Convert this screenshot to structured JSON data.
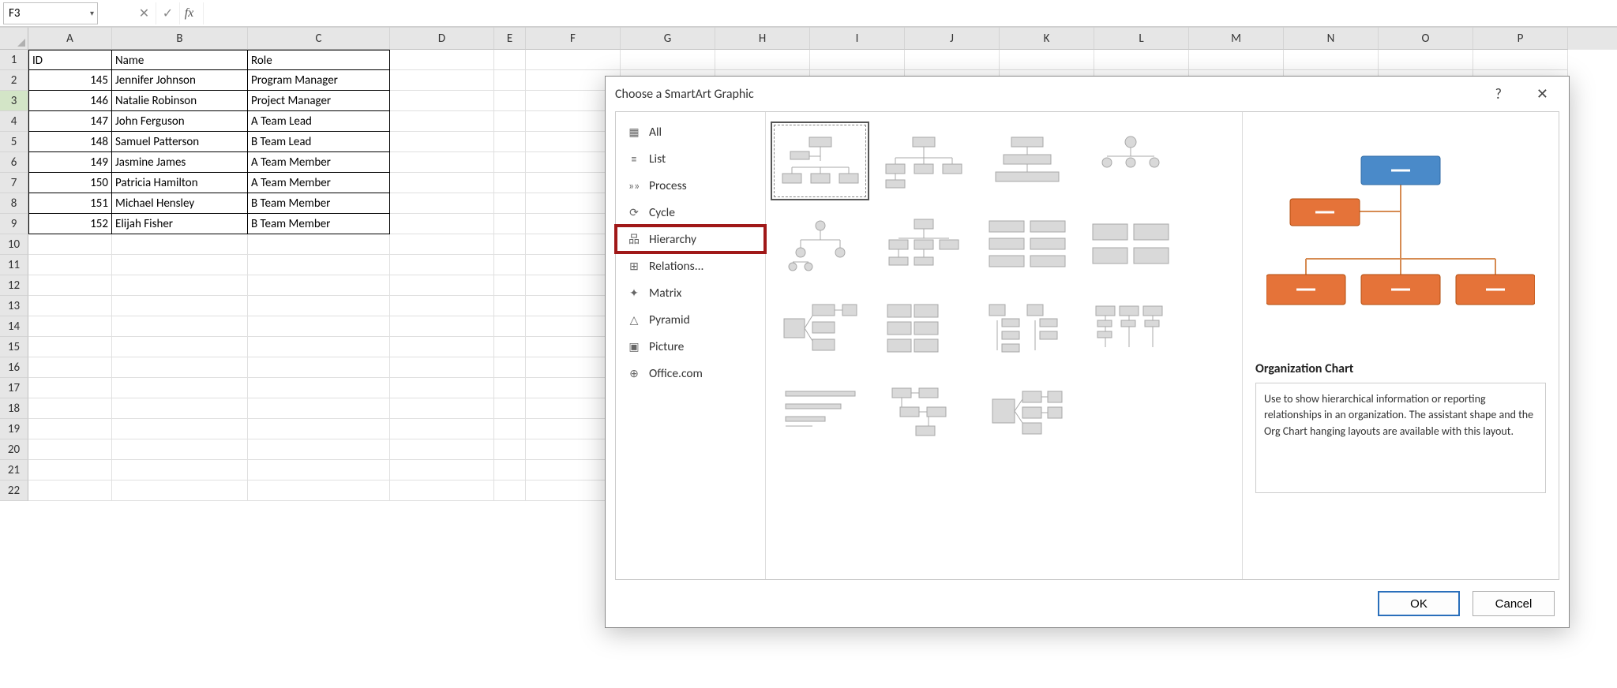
{
  "formula_bar": {
    "cell_ref": "F3",
    "fx": "fx",
    "value": ""
  },
  "columns": [
    "A",
    "B",
    "C",
    "D",
    "E",
    "F",
    "G",
    "H",
    "I",
    "J",
    "K",
    "L",
    "M",
    "N",
    "O",
    "P"
  ],
  "row_numbers": [
    1,
    2,
    3,
    4,
    5,
    6,
    7,
    8,
    9,
    10,
    11,
    12,
    13,
    14,
    15,
    16,
    17,
    18,
    19,
    20,
    21,
    22
  ],
  "selected_row_header": 3,
  "table": {
    "headers": {
      "id": "ID",
      "name": "Name",
      "role": "Role"
    },
    "rows": [
      {
        "id": "145",
        "name": "Jennifer Johnson",
        "role": "Program Manager"
      },
      {
        "id": "146",
        "name": "Natalie Robinson",
        "role": "Project Manager"
      },
      {
        "id": "147",
        "name": "John Ferguson",
        "role": "A Team Lead"
      },
      {
        "id": "148",
        "name": "Samuel Patterson",
        "role": "B Team Lead"
      },
      {
        "id": "149",
        "name": "Jasmine James",
        "role": "A Team Member"
      },
      {
        "id": "150",
        "name": "Patricia Hamilton",
        "role": "A Team Member"
      },
      {
        "id": "151",
        "name": "Michael Hensley",
        "role": "B Team Member"
      },
      {
        "id": "152",
        "name": "Elijah Fisher",
        "role": "B Team Member"
      }
    ]
  },
  "dialog": {
    "title": "Choose a SmartArt Graphic",
    "help": "?",
    "close": "✕",
    "categories": [
      {
        "label": "All",
        "icon": "▦"
      },
      {
        "label": "List",
        "icon": "≡"
      },
      {
        "label": "Process",
        "icon": "»»"
      },
      {
        "label": "Cycle",
        "icon": "⟳"
      },
      {
        "label": "Hierarchy",
        "icon": "品"
      },
      {
        "label": "Relations...",
        "icon": "⊞"
      },
      {
        "label": "Matrix",
        "icon": "✦"
      },
      {
        "label": "Pyramid",
        "icon": "△"
      },
      {
        "label": "Picture",
        "icon": "▣"
      },
      {
        "label": "Office.com",
        "icon": "⊕"
      }
    ],
    "selected_category_index": 4,
    "selected_layout_index": 0,
    "preview": {
      "title": "Organization Chart",
      "desc": "Use to show hierarchical information or reporting relationships in an organization. The assistant shape and the Org Chart hanging layouts are available with this layout."
    },
    "buttons": {
      "ok": "OK",
      "cancel": "Cancel"
    }
  }
}
